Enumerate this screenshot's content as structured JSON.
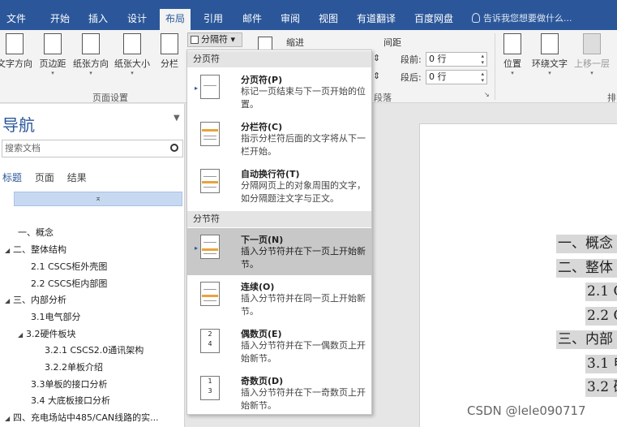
{
  "tabs": [
    "文件",
    "开始",
    "插入",
    "设计",
    "布局",
    "引用",
    "邮件",
    "审阅",
    "视图",
    "有道翻译",
    "百度网盘"
  ],
  "active_tab": "布局",
  "tell_me": "告诉我您想要做什么...",
  "ribbon": {
    "page_setup": {
      "buttons": [
        "文字方向",
        "页边距",
        "纸张方向",
        "纸张大小",
        "分栏"
      ],
      "group_label": "页面设置"
    },
    "breaks_button": "分隔符",
    "indent": {
      "label": "缩进"
    },
    "spacing": {
      "label": "间距",
      "before_label": "段前:",
      "before_value": "0 行",
      "after_label": "段后:",
      "after_value": "0 行"
    },
    "paragraph_group_label": "段落",
    "arrange": {
      "buttons": [
        "位置",
        "环绕文字",
        "上移一层"
      ],
      "group_label_partial": "排"
    }
  },
  "nav_pane": {
    "title": "导航",
    "search_placeholder": "搜索文档",
    "tabs": [
      "标题",
      "页面",
      "结果"
    ],
    "items": [
      "一、概念",
      "二、整体结构",
      "2.1 CSCS柜外壳图",
      "2.2 CSCS柜内部图",
      "三、内部分析",
      "3.1电气部分",
      "3.2硬件板块",
      "3.2.1 CSCS2.0通讯架构",
      "3.2.2单板介绍",
      "3.3单板的接口分析",
      "3.4 大底板接口分析",
      "四、充电场站中485/CAN线路的实..."
    ]
  },
  "breaks_menu": {
    "page_breaks_header": "分页符",
    "section_breaks_header": "分节符",
    "items": [
      {
        "title": "分页符(P)",
        "desc": "标记一页结束与下一页开始的位置。"
      },
      {
        "title": "分栏符(C)",
        "desc": "指示分栏符后面的文字将从下一栏开始。"
      },
      {
        "title": "自动换行符(T)",
        "desc": "分隔网页上的对象周围的文字，如分隔题注文字与正文。"
      },
      {
        "title": "下一页(N)",
        "desc": "插入分节符并在下一页上开始新节。"
      },
      {
        "title": "连续(O)",
        "desc": "插入分节符并在同一页上开始新节。"
      },
      {
        "title": "偶数页(E)",
        "desc": "插入分节符并在下一偶数页上开始新节。"
      },
      {
        "title": "奇数页(D)",
        "desc": "插入分节符并在下一奇数页上开始新节。"
      }
    ],
    "highlighted": "下一页(N)"
  },
  "document": {
    "toc_lines": [
      "一、概念",
      "二、整体",
      "2.1 C",
      "2.2 C",
      "三、内部",
      "3.1 电",
      "3.2 硬"
    ]
  },
  "watermark": "CSDN @lele090717",
  "colors": {
    "ribbon_blue": "#2b579a",
    "ribbon_bg": "#f3f3f3",
    "menu_highlight": "#c8c8c8",
    "nav_collapse": "#c7d9f1",
    "toc_shading": "#d8d8d8"
  }
}
